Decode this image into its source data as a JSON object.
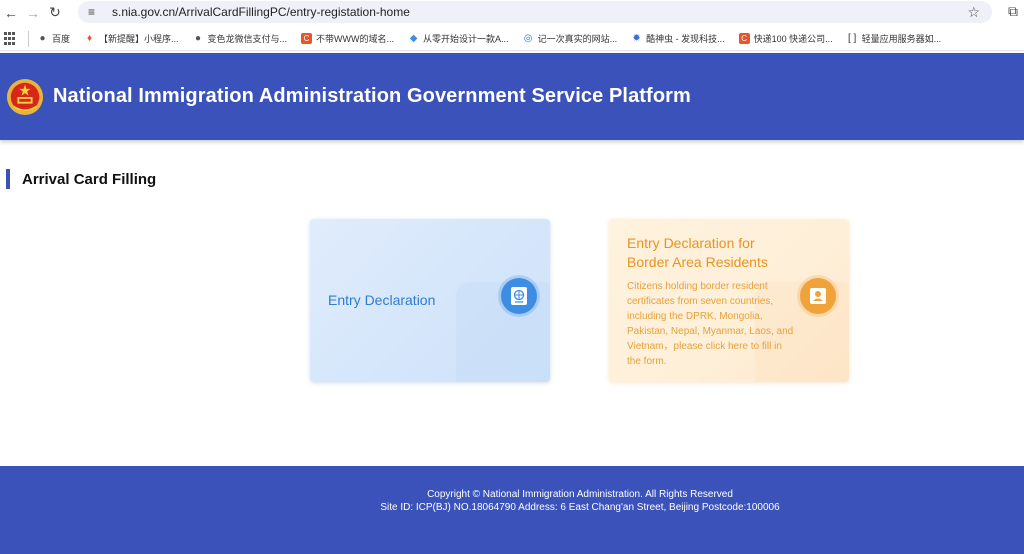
{
  "browser": {
    "url": "s.nia.gov.cn/ArrivalCardFillingPC/entry-registation-home",
    "bookmarks": [
      {
        "label": "百度",
        "icon": "globe-icon",
        "color": "#555555"
      },
      {
        "label": "【新提醒】小程序...",
        "icon": "fire-icon",
        "color": "#e8552b"
      },
      {
        "label": "变色龙微信支付与...",
        "icon": "globe-icon",
        "color": "#555555"
      },
      {
        "label": "不带WWW的域名...",
        "icon": "csdn-icon",
        "color": "#e8552b"
      },
      {
        "label": "从零开始设计一款A...",
        "icon": "diamond-icon",
        "color": "#3a8ee6"
      },
      {
        "label": "记一次真实的网站...",
        "icon": "circle-icon",
        "color": "#2a7ae2"
      },
      {
        "label": "酷神虫 - 发现科技...",
        "icon": "bug-icon",
        "color": "#3a6fd6"
      },
      {
        "label": "快递100 快递公司...",
        "icon": "csdn-icon",
        "color": "#e8552b"
      },
      {
        "label": "轻量应用服务器如...",
        "icon": "bracket-icon",
        "color": "#333333"
      }
    ]
  },
  "header": {
    "title": "National Immigration Administration Government Service Platform",
    "brand_color": "#3a52b9"
  },
  "section": {
    "title": "Arrival Card Filling"
  },
  "cards": {
    "entry": {
      "label": "Entry Declaration",
      "icon": "passport-icon",
      "accent": "#2f7cd3"
    },
    "border": {
      "title": "Entry Declaration for Border Area Residents",
      "description": "Citizens holding border resident certificates from seven countries, including the DPRK, Mongolia, Pakistan, Nepal, Myanmar, Laos, and Vietnam，please click here to fill in the form.",
      "icon": "id-card-icon",
      "accent": "#e8941e"
    }
  },
  "footer": {
    "copyright": "Copyright © National Immigration Administration. All Rights Reserved",
    "site_info": "Site ID: ICP(BJ) NO.18064790 Address: 6 East Chang'an Street, Beijing Postcode:100006"
  }
}
